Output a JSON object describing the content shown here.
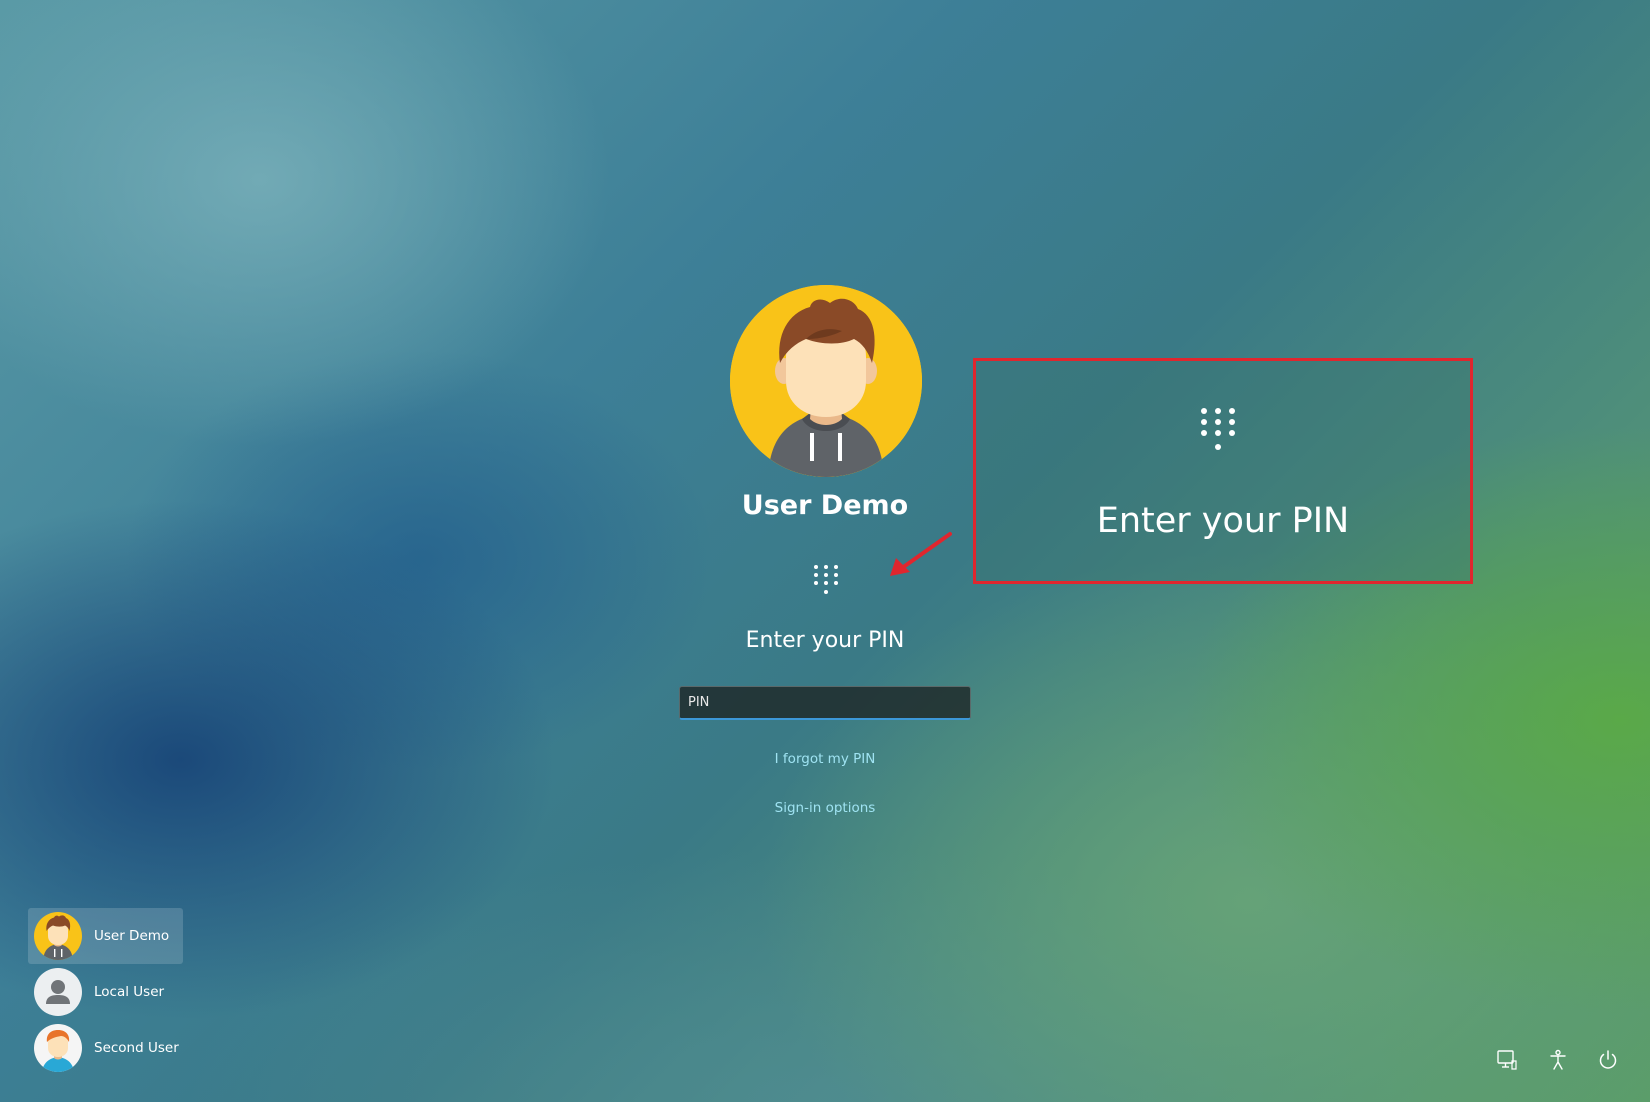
{
  "login": {
    "user_name": "User Demo",
    "pin_title": "Enter your PIN",
    "pin_placeholder": "PIN",
    "forgot_link": "I forgot my PIN",
    "signin_options_link": "Sign-in options"
  },
  "callout": {
    "title": "Enter your PIN",
    "border_color": "#e0262e"
  },
  "users": [
    {
      "name": "User Demo",
      "avatar": "person-avatar-yellow",
      "active": true
    },
    {
      "name": "Local User",
      "avatar": "default-user-icon",
      "active": false
    },
    {
      "name": "Second User",
      "avatar": "person-avatar-blue",
      "active": false
    }
  ],
  "system_icons": [
    "network-icon",
    "accessibility-icon",
    "power-icon"
  ],
  "colors": {
    "link": "#9fe3f2",
    "input_accent": "#3c98d8",
    "avatar_yellow": "#f9c318"
  }
}
